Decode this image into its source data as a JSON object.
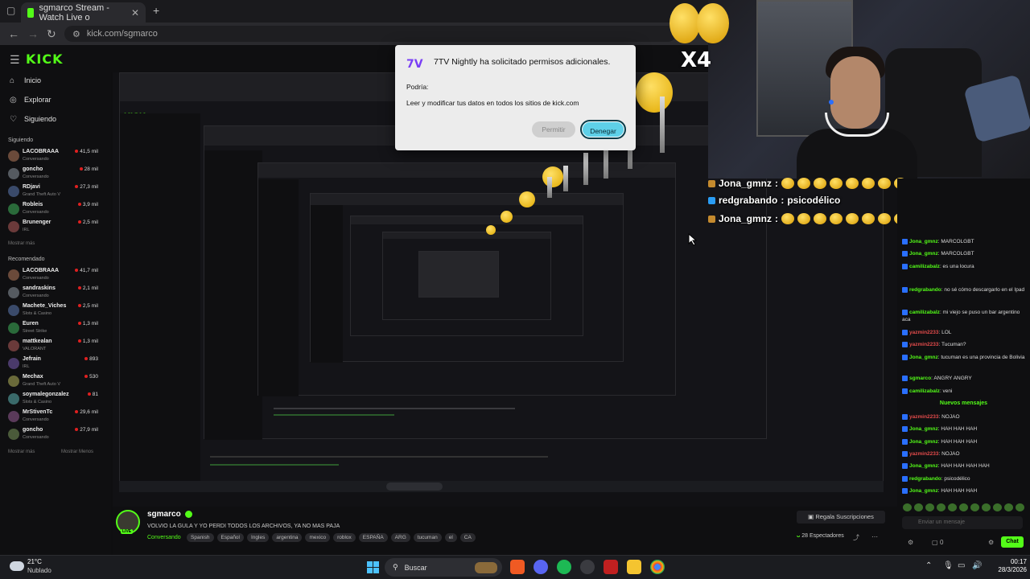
{
  "browser": {
    "tab_title": "sgmarco Stream - Watch Live o",
    "url": "kick.com/sgmarco"
  },
  "kick": {
    "logo": "KICK",
    "nav": [
      {
        "label": "Inicio",
        "icon": "home-icon"
      },
      {
        "label": "Explorar",
        "icon": "compass-icon"
      },
      {
        "label": "Siguiendo",
        "icon": "heart-icon"
      }
    ],
    "following_title": "Siguiendo",
    "following": [
      {
        "name": "LACOBRAAA",
        "category": "Conversando",
        "viewers": "41,5 mil"
      },
      {
        "name": "goncho",
        "category": "Conversando",
        "viewers": "28 mil"
      },
      {
        "name": "RDjavi",
        "category": "Grand Theft Auto V",
        "viewers": "27,3 mil"
      },
      {
        "name": "Robleis",
        "category": "Conversando",
        "viewers": "3,9 mil"
      },
      {
        "name": "Brunenger",
        "category": "IRL",
        "viewers": "2,5 mil"
      }
    ],
    "show_more": "Mostrar más",
    "recommended_title": "Recomendado",
    "recommended": [
      {
        "name": "LACOBRAAA",
        "category": "Conversando",
        "viewers": "41,7 mil"
      },
      {
        "name": "sandraskins",
        "category": "Conversando",
        "viewers": "2,1 mil"
      },
      {
        "name": "Machete_Viches",
        "category": "Slots & Casino",
        "viewers": "2,5 mil"
      },
      {
        "name": "Euren",
        "category": "Street Strike",
        "viewers": "1,3 mil"
      },
      {
        "name": "mattkealan",
        "category": "VALORANT",
        "viewers": "1,3 mil"
      },
      {
        "name": "Jefrain",
        "category": "IRL",
        "viewers": "893"
      },
      {
        "name": "Mechax",
        "category": "Grand Theft Auto V",
        "viewers": "530"
      },
      {
        "name": "soymalegonzalez",
        "category": "Slots & Casino",
        "viewers": "81"
      },
      {
        "name": "MrStivenTc",
        "category": "Conversando",
        "viewers": "29,6 mil"
      },
      {
        "name": "goncho",
        "category": "Conversando",
        "viewers": "27,9 mil"
      }
    ],
    "show_more_recommended": "Mostrar más",
    "show_less": "Mostrar Menos"
  },
  "dialog": {
    "title": "7TV Nightly ha solicitado permisos adicionales.",
    "subtitle": "Podría:",
    "permission": "Leer y modificar tus datos en todos los sitios de kick.com",
    "allow": "Permitir",
    "deny": "Denegar"
  },
  "emote_overlay": {
    "multiplier": "X4"
  },
  "overlay_chat": [
    {
      "user": "Jona_gmnz",
      "sep": " :",
      "text": "",
      "emotes": 8
    },
    {
      "user": "redgrabando",
      "sep": " :",
      "text": " psicodélico",
      "emotes": 0
    },
    {
      "user": "Jona_gmnz",
      "sep": " :",
      "text": "",
      "emotes": 8
    }
  ],
  "chat": {
    "messages": [
      {
        "user": "Jona_gmnz",
        "text": ": MARCOLGBT",
        "color": "green"
      },
      {
        "user": "Jona_gmnz",
        "text": ": MARCOLGBT",
        "color": "green"
      },
      {
        "user": "camilizabalz",
        "text": ": es una locura",
        "color": "green"
      },
      {
        "user": "redgrabando",
        "text": ": no sé cómo descargarlo en el Ipad",
        "color": "green"
      },
      {
        "user": "camilizabalz",
        "text": ": mi viejo se puso un bar argentino aca",
        "color": "green"
      },
      {
        "user": "yazmin2233",
        "text": ": LOL",
        "color": "red"
      },
      {
        "user": "yazmin2233",
        "text": ": Tucuman?",
        "color": "red"
      },
      {
        "user": "Jona_gmnz",
        "text": ": tucuman es una provincia de Bolivia",
        "color": "green"
      },
      {
        "user": "sgmarco",
        "text": ": ANGRY ANGRY",
        "color": "green"
      },
      {
        "user": "camilizabalz",
        "text": ": veni",
        "color": "green"
      }
    ],
    "new_messages": "Nuevos mensajes",
    "messages2": [
      {
        "user": "yazmin2233",
        "text": ": NOJAO",
        "color": "red"
      },
      {
        "user": "Jona_gmnz",
        "text": ": HAH HAH HAH",
        "color": "green"
      },
      {
        "user": "Jona_gmnz",
        "text": ": HAH HAH HAH",
        "color": "green"
      },
      {
        "user": "yazmin2233",
        "text": ": NOJAO",
        "color": "red"
      },
      {
        "user": "Jona_gmnz",
        "text": ": HAH HAH HAH HAH",
        "color": "green"
      },
      {
        "user": "redgrabando",
        "text": ": psicodélico",
        "color": "green"
      },
      {
        "user": "Jona_gmnz",
        "text": ": HAH HAH HAH",
        "color": "green"
      }
    ],
    "input_placeholder": "Enviar un mensaje",
    "send_label": "Chat",
    "points": "0"
  },
  "stream_info": {
    "streamer": "sgmarco",
    "live_badge": "LIVE",
    "title": "VOLVIO LA GULA Y YO PERDI TODOS LOS ARCHIVOS, YA NO MAS PAJA",
    "category": "Conversando",
    "tags": [
      "Spanish",
      "Español",
      "Ingles",
      "argentina",
      "mexico",
      "roblox",
      "ESPAÑA",
      "ARG",
      "tucuman",
      "el",
      "CA"
    ],
    "subs_button": "Regala Suscripciones",
    "viewers": "28 Espectadores"
  },
  "taskbar": {
    "weather_temp": "21°C",
    "weather_desc": "Nublado",
    "search_label": "Buscar",
    "time": "00:17",
    "date": "28/3/2026"
  },
  "colors": {
    "kick_green": "#53fc18",
    "deny_button": "#5ed0e8",
    "dialog_bg": "#ececec",
    "seventv_purple": "#7a3ff5"
  }
}
